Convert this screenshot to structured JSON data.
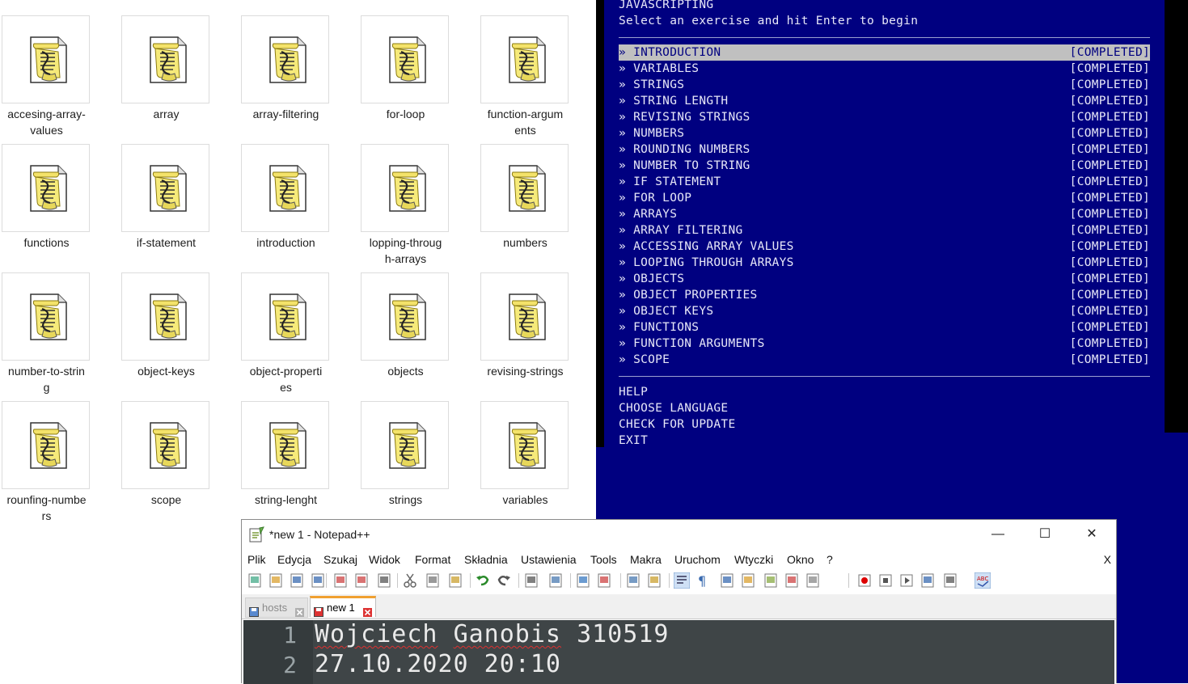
{
  "explorer": {
    "files": [
      {
        "name": "accesing-array-values",
        "display": "accesing-array-\nvalues"
      },
      {
        "name": "array",
        "display": "array"
      },
      {
        "name": "array-filtering",
        "display": "array-filtering"
      },
      {
        "name": "for-loop",
        "display": "for-loop"
      },
      {
        "name": "function-arguments",
        "display": "function-argum\nents"
      },
      {
        "name": "functions",
        "display": "functions"
      },
      {
        "name": "if-statement",
        "display": "if-statement"
      },
      {
        "name": "introduction",
        "display": "introduction"
      },
      {
        "name": "lopping-through-arrays",
        "display": "lopping-throug\nh-arrays"
      },
      {
        "name": "numbers",
        "display": "numbers"
      },
      {
        "name": "number-to-string",
        "display": "number-to-strin\ng"
      },
      {
        "name": "object-keys",
        "display": "object-keys"
      },
      {
        "name": "object-properties",
        "display": "object-properti\nes"
      },
      {
        "name": "objects",
        "display": "objects"
      },
      {
        "name": "revising-strings",
        "display": "revising-strings"
      },
      {
        "name": "rounfing-numbers",
        "display": "rounfing-numbe\nrs"
      },
      {
        "name": "scope",
        "display": "scope"
      },
      {
        "name": "string-lenght",
        "display": "string-lenght"
      },
      {
        "name": "strings",
        "display": "strings"
      },
      {
        "name": "variables",
        "display": "variables"
      }
    ],
    "file_icon": "script-scroll-icon"
  },
  "terminal": {
    "title": "JAVASCRIPTING",
    "subtitle": "Select an exercise and hit Enter to begin",
    "bullet": "»",
    "exercises": [
      {
        "label": "INTRODUCTION",
        "status": "[COMPLETED]",
        "selected": true
      },
      {
        "label": "VARIABLES",
        "status": "[COMPLETED]"
      },
      {
        "label": "STRINGS",
        "status": "[COMPLETED]"
      },
      {
        "label": "STRING LENGTH",
        "status": "[COMPLETED]"
      },
      {
        "label": "REVISING STRINGS",
        "status": "[COMPLETED]"
      },
      {
        "label": "NUMBERS",
        "status": "[COMPLETED]"
      },
      {
        "label": "ROUNDING NUMBERS",
        "status": "[COMPLETED]"
      },
      {
        "label": "NUMBER TO STRING",
        "status": "[COMPLETED]"
      },
      {
        "label": "IF STATEMENT",
        "status": "[COMPLETED]"
      },
      {
        "label": "FOR LOOP",
        "status": "[COMPLETED]"
      },
      {
        "label": "ARRAYS",
        "status": "[COMPLETED]"
      },
      {
        "label": "ARRAY FILTERING",
        "status": "[COMPLETED]"
      },
      {
        "label": "ACCESSING ARRAY VALUES",
        "status": "[COMPLETED]"
      },
      {
        "label": "LOOPING THROUGH ARRAYS",
        "status": "[COMPLETED]"
      },
      {
        "label": "OBJECTS",
        "status": "[COMPLETED]"
      },
      {
        "label": "OBJECT PROPERTIES",
        "status": "[COMPLETED]"
      },
      {
        "label": "OBJECT KEYS",
        "status": "[COMPLETED]"
      },
      {
        "label": "FUNCTIONS",
        "status": "[COMPLETED]"
      },
      {
        "label": "FUNCTION ARGUMENTS",
        "status": "[COMPLETED]"
      },
      {
        "label": "SCOPE",
        "status": "[COMPLETED]"
      }
    ],
    "extra_menu": [
      "HELP",
      "CHOOSE LANGUAGE",
      "CHECK FOR UPDATE",
      "EXIT"
    ],
    "colors": {
      "background": "#000080",
      "highlight": "#c0c0c0",
      "text": "#e8e8f8"
    }
  },
  "notepad": {
    "title": "*new 1 - Notepad++",
    "window_controls": {
      "minimize": "—",
      "maximize": "☐",
      "close": "✕"
    },
    "menu": [
      "Plik",
      "Edycja",
      "Szukaj",
      "Widok",
      "Format",
      "Składnia",
      "Ustawienia",
      "Tools",
      "Makra",
      "Uruchom",
      "Wtyczki",
      "Okno",
      "?"
    ],
    "close_doc": "X",
    "toolbar_icons": [
      "new-file-icon",
      "open-file-icon",
      "save-icon",
      "save-all-icon",
      "close-icon",
      "close-all-icon",
      "print-icon",
      "cut-icon",
      "copy-icon",
      "paste-icon",
      "undo-icon",
      "redo-icon",
      "find-icon",
      "replace-icon",
      "zoom-in-icon",
      "zoom-out-icon",
      "sync-vertical-icon",
      "sync-horizontal-icon",
      "word-wrap-icon",
      "show-all-chars-icon",
      "indent-guide-icon",
      "doc-map-icon",
      "function-list-icon",
      "folder-as-workspace-icon",
      "monitoring-icon",
      "record-macro-icon",
      "stop-macro-icon",
      "play-macro-icon",
      "run-macro-multiple-icon",
      "save-macro-icon",
      "spell-check-icon"
    ],
    "tabs": [
      {
        "label": "hosts",
        "active": false
      },
      {
        "label": "new 1",
        "active": true
      }
    ],
    "lines": [
      {
        "number": "1",
        "text": "Wojciech Ganobis 310519"
      },
      {
        "number": "2",
        "text": "27.10.2020 20:10"
      }
    ],
    "colors": {
      "editor_bg": "#3f4547",
      "gutter_bg": "#353b3d",
      "tab_accent": "#f0a030"
    }
  }
}
